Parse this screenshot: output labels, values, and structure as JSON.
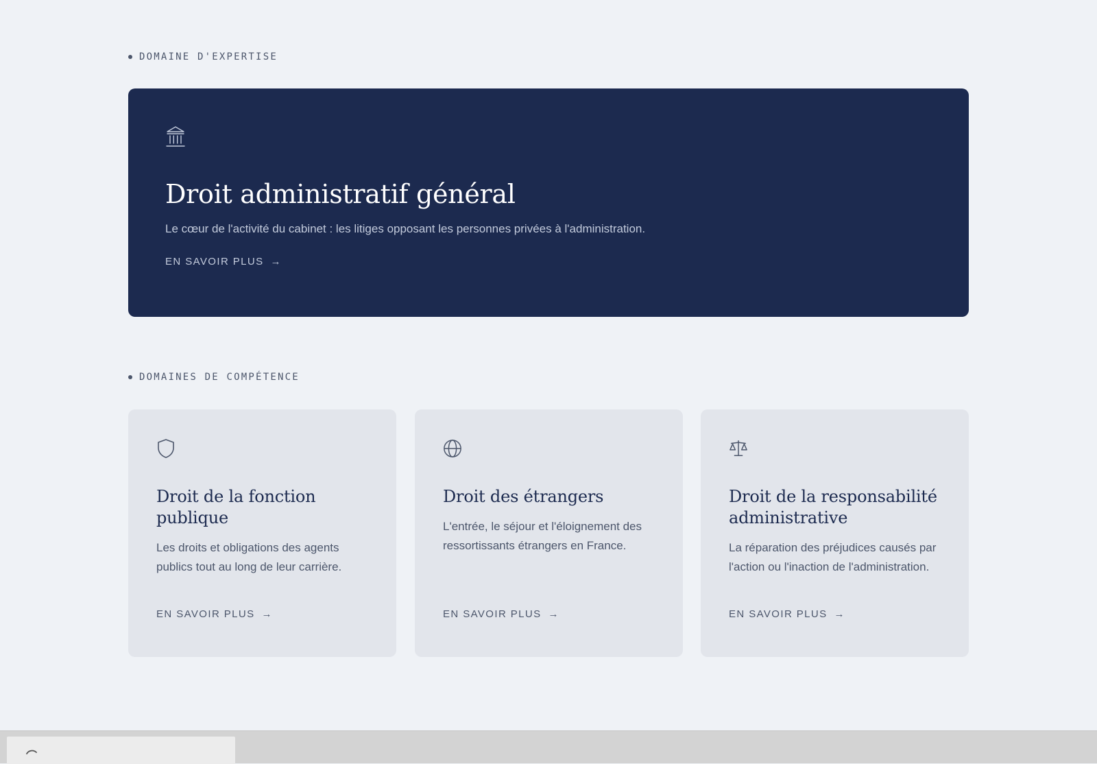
{
  "expertise": {
    "eyebrow": "DOMAINE D'EXPERTISE",
    "icon": "bank-icon",
    "title": "Droit administratif général",
    "description": "Le cœur de l'activité du cabinet : les litiges opposant les personnes privées à l'administration.",
    "link_label": "EN SAVOIR PLUS",
    "arrow": "→"
  },
  "competences": {
    "eyebrow": "DOMAINES DE COMPÉTENCE",
    "cards": [
      {
        "icon": "shield-icon",
        "title": "Droit de la fonction publique",
        "description": "Les droits et obligations des agents publics tout au long de leur carrière.",
        "link_label": "EN SAVOIR PLUS",
        "arrow": "→"
      },
      {
        "icon": "globe-icon",
        "title": "Droit des étrangers",
        "description": "L'entrée, le séjour et l'éloignement des ressortissants étrangers en France.",
        "link_label": "EN SAVOIR PLUS",
        "arrow": "→"
      },
      {
        "icon": "scales-icon",
        "title": "Droit de la responsabilité administrative",
        "description": "La réparation des préjudices causés par l'action ou l'inaction de l'administration.",
        "link_label": "EN SAVOIR PLUS",
        "arrow": "→"
      }
    ]
  },
  "colors": {
    "page_background": "#eff2f6",
    "hero_background": "#1c2a4f",
    "card_background": "#e2e5eb",
    "accent_text": "#4c566b"
  },
  "status_bar": {
    "icon": "loading-spinner-icon"
  }
}
